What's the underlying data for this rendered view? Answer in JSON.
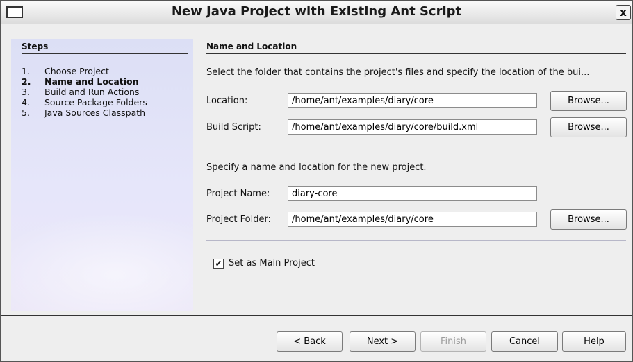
{
  "window": {
    "title": "New Java Project with Existing Ant Script",
    "close_label": "x"
  },
  "steps": {
    "header": "Steps",
    "items": [
      {
        "num": "1.",
        "label": "Choose Project",
        "active": false
      },
      {
        "num": "2.",
        "label": "Name and Location",
        "active": true
      },
      {
        "num": "3.",
        "label": "Build and Run Actions",
        "active": false
      },
      {
        "num": "4.",
        "label": "Source Package Folders",
        "active": false
      },
      {
        "num": "5.",
        "label": "Java Sources Classpath",
        "active": false
      }
    ]
  },
  "main": {
    "section_title": "Name and Location",
    "instruction_1": "Select the folder that contains the project's files and specify the location of the bui...",
    "location": {
      "label": "Location:",
      "value": "/home/ant/examples/diary/core",
      "browse": "Browse..."
    },
    "build_script": {
      "label": "Build Script:",
      "value": "/home/ant/examples/diary/core/build.xml",
      "browse": "Browse..."
    },
    "instruction_2": "Specify a name and location for the new project.",
    "project_name": {
      "label": "Project Name:",
      "value": "diary-core"
    },
    "project_folder": {
      "label": "Project Folder:",
      "value": "/home/ant/examples/diary/core",
      "browse": "Browse..."
    },
    "main_project": {
      "label": "Set as Main Project",
      "checked": true
    }
  },
  "footer": {
    "back": "< Back",
    "next": "Next >",
    "finish": "Finish",
    "cancel": "Cancel",
    "help": "Help"
  }
}
